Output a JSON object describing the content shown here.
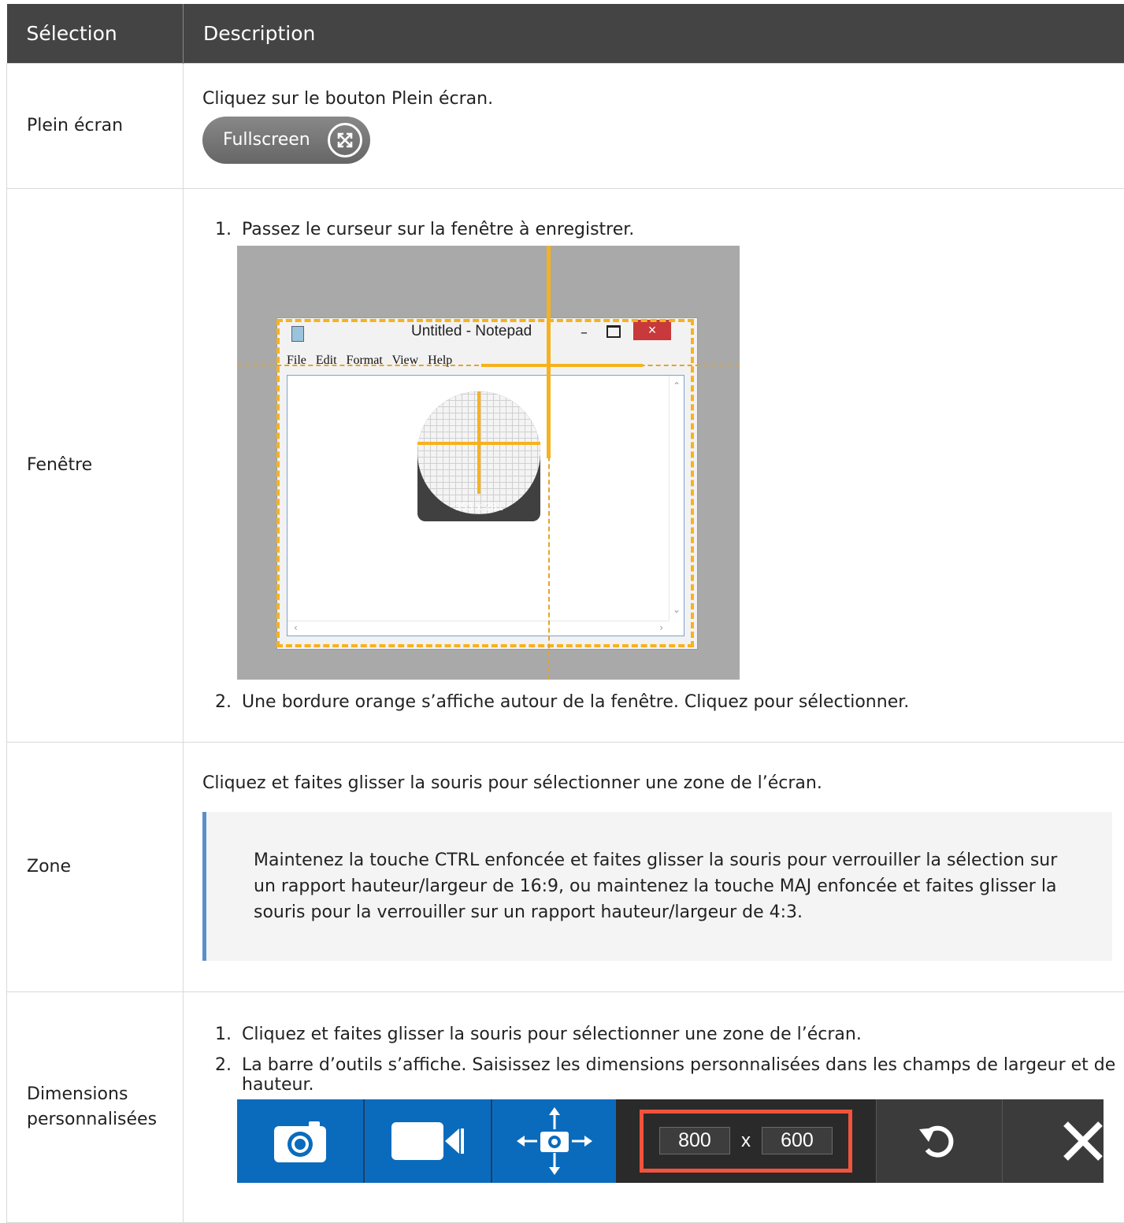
{
  "table": {
    "headers": [
      "Sélection",
      "Description"
    ],
    "rows": {
      "fullscreen": {
        "label": "Plein écran",
        "instruction": "Cliquez sur le bouton Plein écran.",
        "button_label": "Fullscreen"
      },
      "window": {
        "label": "Fenêtre",
        "step1": "Passez le curseur sur la fenêtre à enregistrer.",
        "step2": "Une bordure orange s’affiche autour de la fenêtre. Cliquez pour sélectionner.",
        "notepad": {
          "title": "Untitled - Notepad",
          "close": "×",
          "menu": "File Edit Format View Help",
          "magnifier_size": "353 x 281",
          "highlight_color": "#f6b21e"
        }
      },
      "region": {
        "label": "Zone",
        "instruction": "Cliquez et faites glisser la souris pour sélectionner une zone de l’écran.",
        "note": "Maintenez la touche CTRL enfoncée et faites glisser la souris pour verrouiller la sélection sur un rapport hauteur/largeur de 16:9, ou maintenez la touche MAJ enfoncée et faites glisser la souris pour la verrouiller sur un rapport hauteur/largeur de 4:3."
      },
      "custom": {
        "label": "Dimensions personnalisées",
        "step1": "Cliquez et faites glisser la souris pour sélectionner une zone de l’écran.",
        "step2": "La barre d’outils s’affiche. Saisissez les dimensions personnalisées dans les champs de largeur et de hauteur.",
        "toolbar": {
          "width_value": "800",
          "times": "x",
          "height_value": "600",
          "accent_color": "#f0543c",
          "icons": [
            "camera-icon",
            "video-camera-icon",
            "move-icon",
            "reset-icon",
            "close-icon"
          ]
        }
      }
    }
  }
}
